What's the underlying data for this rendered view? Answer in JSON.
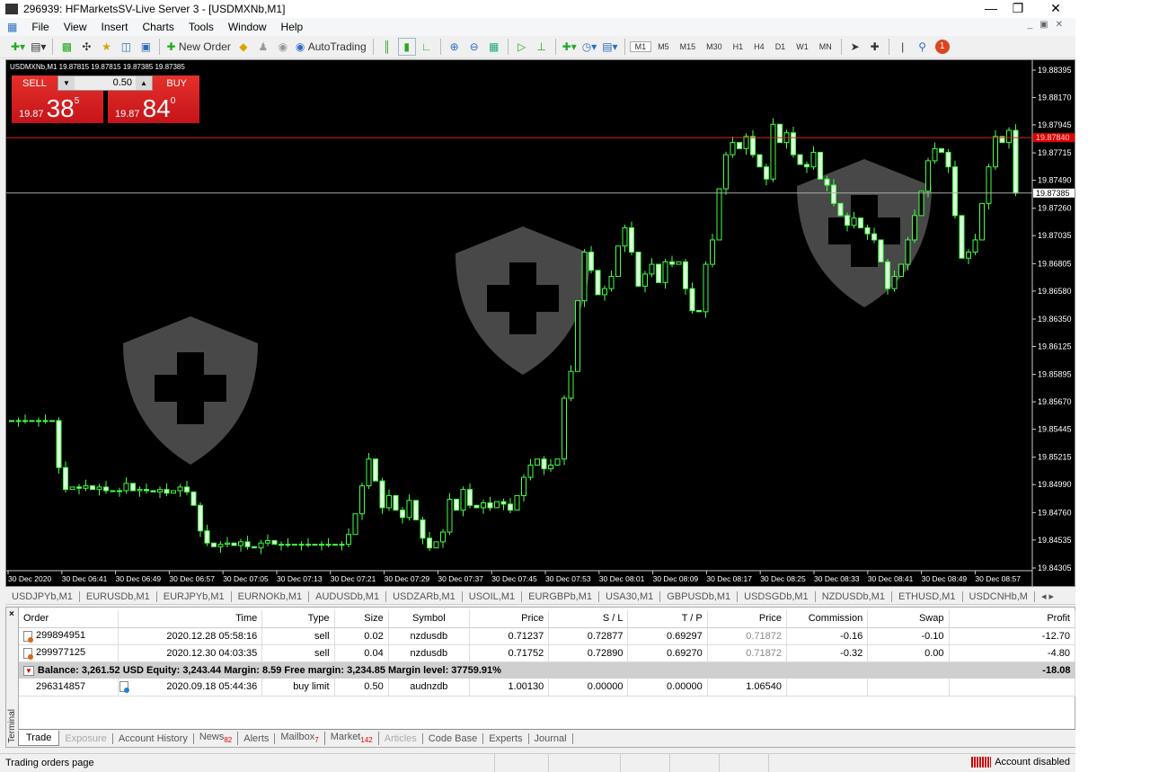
{
  "window": {
    "title": "296939: HFMarketsSV-Live Server 3 - [USDMXNb,M1]"
  },
  "menu": [
    "File",
    "View",
    "Insert",
    "Charts",
    "Tools",
    "Window",
    "Help"
  ],
  "toolbar": {
    "new_order": "New Order",
    "autotrading": "AutoTrading",
    "timeframes": [
      "M1",
      "M5",
      "M15",
      "M30",
      "H1",
      "H4",
      "D1",
      "W1",
      "MN"
    ],
    "active_timeframe": "M1",
    "notification_count": "1"
  },
  "chart": {
    "header": "USDMXNb,M1  19.87815 19.87815 19.87385 19.87385",
    "one_click": {
      "sell": "SELL",
      "buy": "BUY",
      "lot": "0.50",
      "sell_prefix": "19.87",
      "sell_big": "38",
      "sell_sup": "5",
      "buy_prefix": "19.87",
      "buy_big": "84",
      "buy_sup": "0"
    },
    "bid_label": "19.87385",
    "ask_label": "19.87840"
  },
  "chart_data": {
    "type": "candlestick",
    "symbol": "USDMXNb",
    "timeframe": "M1",
    "ylim": [
      19.84305,
      19.88395
    ],
    "y_ticks": [
      "19.88395",
      "19.88170",
      "19.87945",
      "19.87715",
      "19.87490",
      "19.87260",
      "19.87035",
      "19.86805",
      "19.86580",
      "19.86350",
      "19.86125",
      "19.85895",
      "19.85670",
      "19.85445",
      "19.85215",
      "19.84990",
      "19.84760",
      "19.84535",
      "19.84305"
    ],
    "x_ticks": [
      "30 Dec 2020",
      "30 Dec 06:41",
      "30 Dec 06:49",
      "30 Dec 06:57",
      "30 Dec 07:05",
      "30 Dec 07:13",
      "30 Dec 07:21",
      "30 Dec 07:29",
      "30 Dec 07:37",
      "30 Dec 07:45",
      "30 Dec 07:53",
      "30 Dec 08:01",
      "30 Dec 08:09",
      "30 Dec 08:17",
      "30 Dec 08:25",
      "30 Dec 08:33",
      "30 Dec 08:41",
      "30 Dec 08:49",
      "30 Dec 08:57"
    ],
    "bid": 19.87385,
    "ask": 19.8784,
    "closes": [
      19.85516,
      19.85516,
      19.85516,
      19.85516,
      19.85516,
      19.85516,
      19.85516,
      19.8513,
      19.8495,
      19.8497,
      19.8496,
      19.8498,
      19.8495,
      19.8497,
      19.8494,
      19.8494,
      19.8494,
      19.85,
      19.8494,
      19.8495,
      19.8494,
      19.8493,
      19.8495,
      19.8492,
      19.8494,
      19.8497,
      19.8493,
      19.8482,
      19.8461,
      19.8451,
      19.8448,
      19.845,
      19.8451,
      19.8449,
      19.8452,
      19.8448,
      19.8447,
      19.8451,
      19.8453,
      19.845,
      19.845,
      19.845,
      19.845,
      19.845,
      19.845,
      19.845,
      19.845,
      19.845,
      19.845,
      19.845,
      19.8458,
      19.8475,
      19.8498,
      19.852,
      19.8502,
      19.848,
      19.849,
      19.8478,
      19.8472,
      19.8486,
      19.847,
      19.8455,
      19.8447,
      19.8452,
      19.846,
      19.8487,
      19.8478,
      19.8495,
      19.8482,
      19.848,
      19.8484,
      19.848,
      19.8485,
      19.8483,
      19.8478,
      19.849,
      19.8505,
      19.8515,
      19.852,
      19.8512,
      19.8515,
      19.852,
      19.857,
      19.8592,
      19.865,
      19.869,
      19.8675,
      19.8655,
      19.866,
      19.867,
      19.8695,
      19.871,
      19.869,
      19.8662,
      19.8672,
      19.868,
      19.8665,
      19.8682,
      19.868,
      19.8682,
      19.866,
      19.8642,
      19.8641,
      19.868,
      19.87,
      19.8742,
      19.877,
      19.878,
      19.8775,
      19.8785,
      19.877,
      19.876,
      19.875,
      19.8795,
      19.878,
      19.8788,
      19.877,
      19.8762,
      19.876,
      19.8772,
      19.875,
      19.8745,
      19.873,
      19.872,
      19.8712,
      19.8718,
      19.871,
      19.8705,
      19.87,
      19.8682,
      19.866,
      19.867,
      19.868,
      19.87,
      19.872,
      19.874,
      19.8765,
      19.8775,
      19.8772,
      19.876,
      19.872,
      19.8685,
      19.869,
      19.87,
      19.873,
      19.876,
      19.8785,
      19.878,
      19.879,
      19.87385
    ]
  },
  "symbol_tabs": [
    "USDJPYb,M1",
    "EURUSDb,M1",
    "EURJPYb,M1",
    "EURNOKb,M1",
    "AUDUSDb,M1",
    "USDZARb,M1",
    "USOIL,M1",
    "EURGBPb,M1",
    "USA30,M1",
    "GBPUSDb,M1",
    "USDSGDb,M1",
    "NZDUSDb,M1",
    "ETHUSD,M1",
    "USDCNHb,M"
  ],
  "terminal": {
    "label": "Terminal",
    "columns": [
      "Order",
      "Time",
      "Type",
      "Size",
      "Symbol",
      "Price",
      "S / L",
      "T / P",
      "Price",
      "Commission",
      "Swap",
      "Profit"
    ],
    "rows": [
      {
        "order": "299894951",
        "time": "2020.12.28 05:58:16",
        "type": "sell",
        "size": "0.02",
        "symbol": "nzdusdb",
        "price": "0.71237",
        "sl": "0.72877",
        "tp": "0.69297",
        "cur": "0.71872",
        "commission": "-0.16",
        "swap": "-0.10",
        "profit": "-12.70"
      },
      {
        "order": "299977125",
        "time": "2020.12.30 04:03:35",
        "type": "sell",
        "size": "0.04",
        "symbol": "nzdusdb",
        "price": "0.71752",
        "sl": "0.72890",
        "tp": "0.69270",
        "cur": "0.71872",
        "commission": "-0.32",
        "swap": "0.00",
        "profit": "-4.80"
      }
    ],
    "balance_line": "Balance: 3,261.52 USD  Equity: 3,243.44  Margin: 8.59  Free margin: 3,234.85  Margin level: 37759.91%",
    "total_profit": "-18.08",
    "pending": {
      "order": "296314857",
      "time": "2020.09.18 05:44:36",
      "type": "buy limit",
      "size": "0.50",
      "symbol": "audnzdb",
      "price": "1.00130",
      "sl": "0.00000",
      "tp": "0.00000",
      "cur": "1.06540"
    },
    "tabs": [
      {
        "label": "Trade"
      },
      {
        "label": "Exposure"
      },
      {
        "label": "Account History"
      },
      {
        "label": "News",
        "badge": "82"
      },
      {
        "label": "Alerts"
      },
      {
        "label": "Mailbox",
        "badge": "7"
      },
      {
        "label": "Market",
        "badge": "142"
      },
      {
        "label": "Articles"
      },
      {
        "label": "Code Base"
      },
      {
        "label": "Experts"
      },
      {
        "label": "Journal"
      }
    ]
  },
  "status": {
    "left": "Trading orders page",
    "right": "Account disabled"
  }
}
